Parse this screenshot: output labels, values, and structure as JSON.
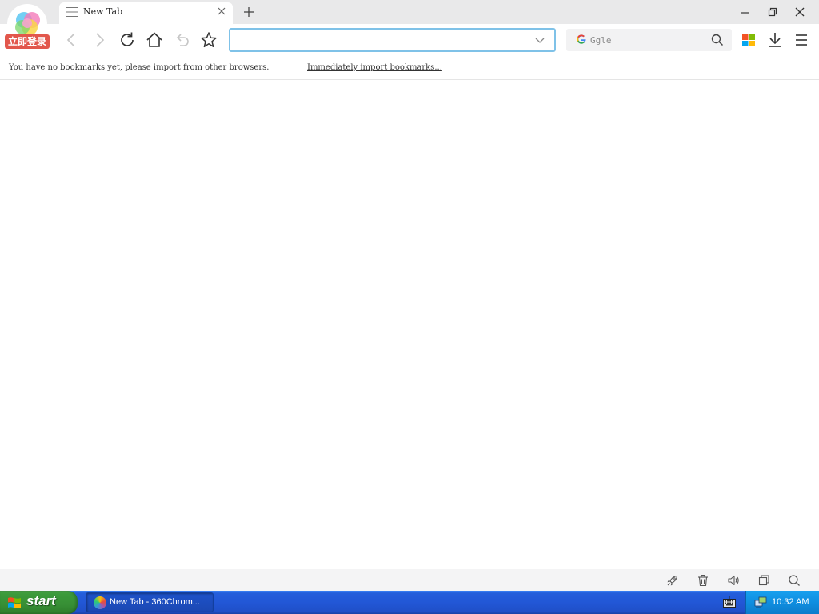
{
  "browser": {
    "login_badge": "立即登录",
    "tabs": [
      {
        "title": "New Tab",
        "active": true
      }
    ],
    "address_bar": {
      "value": "",
      "placeholder": ""
    },
    "search": {
      "placeholder": "Ggle",
      "engine_icon": "G"
    },
    "bookmarks_bar": {
      "message": "You have no bookmarks yet, please import from other browsers.",
      "import_link": "Immediately import bookmarks..."
    }
  },
  "taskbar": {
    "start_label": "start",
    "task_items": [
      {
        "label": "New Tab - 360Chrom..."
      }
    ],
    "clock": "10:32 AM"
  },
  "colors": {
    "address_border": "#7fc2e8",
    "login_badge": "#e2574c",
    "taskbar_blue": "#245edb",
    "start_green": "#3c9a3a"
  }
}
